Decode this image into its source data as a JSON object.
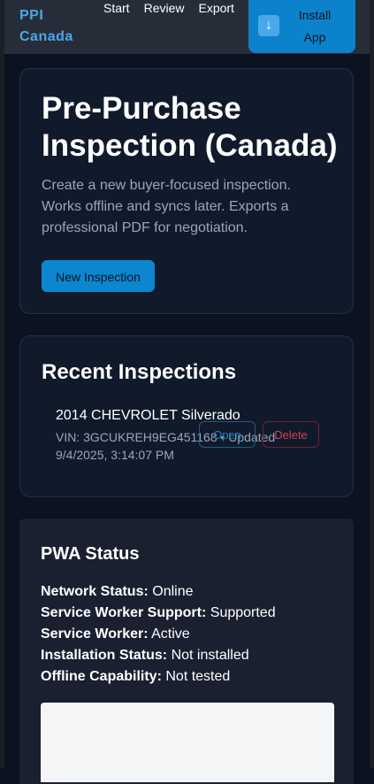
{
  "header": {
    "brand_line1": "PPI",
    "brand_line2": "Canada",
    "nav": [
      "Start",
      "Review",
      "Export"
    ],
    "install_icon": "download-arrow-icon",
    "install_label_line1": "Install",
    "install_label_line2": "App"
  },
  "hero": {
    "title": "Pre-Purchase Inspection (Canada)",
    "description": "Create a new buyer-focused inspection. Works offline and syncs later. Exports a professional PDF for negotiation.",
    "button_label": "New Inspection"
  },
  "recent": {
    "title": "Recent Inspections",
    "items": [
      {
        "name": "2014 CHEVROLET Silverado",
        "meta": "VIN: 3GCUKREH9EG451168 • Updated 9/4/2025, 3:14:07 PM",
        "open_label": "Open",
        "delete_label": "Delete"
      }
    ]
  },
  "pwa": {
    "title": "PWA Status",
    "rows": [
      {
        "label": "Network Status:",
        "value": "Online"
      },
      {
        "label": "Service Worker Support:",
        "value": "Supported"
      },
      {
        "label": "Service Worker:",
        "value": "Active"
      },
      {
        "label": "Installation Status:",
        "value": "Not installed"
      },
      {
        "label": "Offline Capability:",
        "value": "Not tested"
      }
    ]
  },
  "colors": {
    "accent": "#0b86cf",
    "brand": "#4aa8e8",
    "danger": "#d24050",
    "background": "#0b1220"
  }
}
